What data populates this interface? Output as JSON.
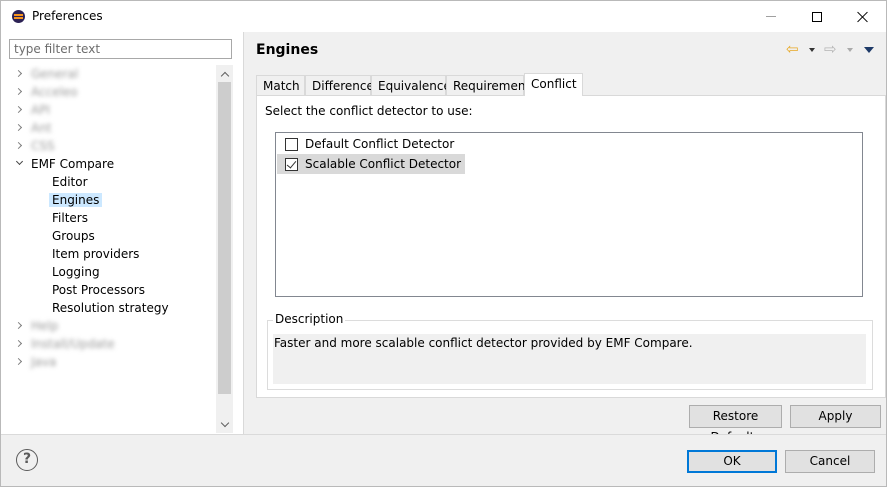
{
  "window": {
    "title": "Preferences"
  },
  "filter": {
    "placeholder": "type filter text"
  },
  "tree": {
    "items": [
      {
        "label": "General",
        "blurred": true
      },
      {
        "label": "Acceleo",
        "blurred": true
      },
      {
        "label": "API",
        "blurred": true
      },
      {
        "label": "Ant",
        "blurred": true
      },
      {
        "label": "CSS",
        "blurred": true
      },
      {
        "label": "EMF Compare",
        "expanded": true,
        "children": [
          "Editor",
          "Engines",
          "Filters",
          "Groups",
          "Item providers",
          "Logging",
          "Post Processors",
          "Resolution strategy"
        ],
        "selected_child": "Engines"
      },
      {
        "label": "Help",
        "blurred": true
      },
      {
        "label": "Install/Update",
        "blurred": true
      },
      {
        "label": "Java",
        "blurred": true
      }
    ]
  },
  "page": {
    "title": "Engines",
    "tabs": [
      "Match",
      "Difference",
      "Equivalence",
      "Requirement",
      "Conflict"
    ],
    "active_tab": "Conflict",
    "prompt": "Select the conflict detector to use:",
    "detectors": [
      {
        "label": "Default Conflict Detector",
        "checked": false
      },
      {
        "label": "Scalable Conflict Detector",
        "checked": true
      }
    ],
    "description_label": "Description",
    "description_text": "Faster and more scalable conflict detector provided by EMF Compare.",
    "restore_label": "Restore Defaults",
    "apply_label": "Apply"
  },
  "footer": {
    "help_glyph": "?",
    "ok_label": "OK",
    "cancel_label": "Cancel"
  },
  "colors": {
    "selection": "#cce8ff",
    "default_button_border": "#0078d7",
    "back_arrow": "#e7a824"
  }
}
